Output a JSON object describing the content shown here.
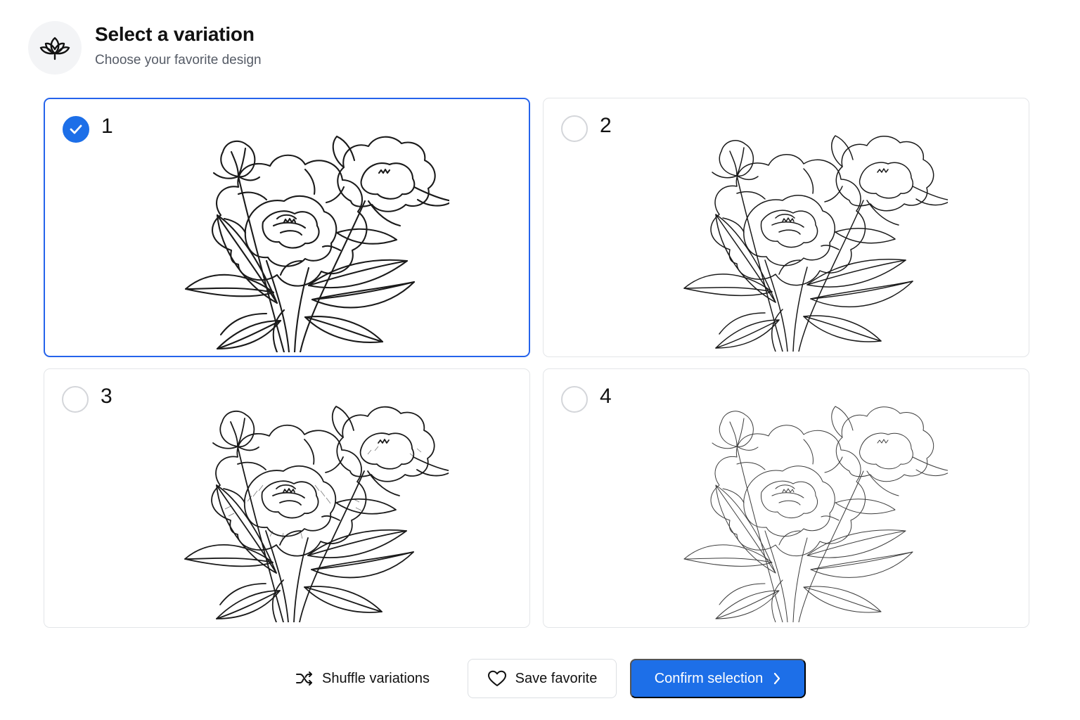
{
  "header": {
    "title": "Select a variation",
    "subtitle": "Choose your favorite design",
    "logo_icon": "lotus-icon"
  },
  "variations": [
    {
      "number": "1",
      "selected": true,
      "style": "bold-outline"
    },
    {
      "number": "2",
      "selected": false,
      "style": "clean-outline"
    },
    {
      "number": "3",
      "selected": false,
      "style": "shaded-detail"
    },
    {
      "number": "4",
      "selected": false,
      "style": "loose-sketch"
    }
  ],
  "actions": {
    "shuffle_label": "Shuffle variations",
    "save_label": "Save favorite",
    "confirm_label": "Confirm selection"
  },
  "colors": {
    "accent": "#1d6fe8",
    "selected_border": "#2563eb",
    "card_border": "#e3e5e8",
    "muted_text": "#555b66"
  }
}
